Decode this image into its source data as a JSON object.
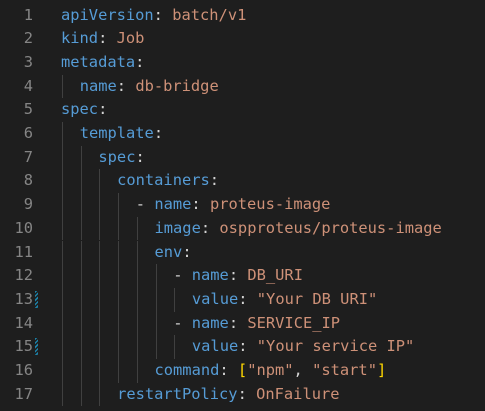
{
  "theme": {
    "background": "#1e1e1e",
    "line_number": "#858585",
    "key": "#569cd6",
    "punctuation": "#d4d4d4",
    "value": "#ce9178",
    "bracket": "#ffd700",
    "modified_gutter": "#1b81a8"
  },
  "lines": [
    {
      "num": "1",
      "indent": 0,
      "tokens": [
        {
          "t": "apiVersion",
          "c": "k"
        },
        {
          "t": ": ",
          "c": "p"
        },
        {
          "t": "batch/v1",
          "c": "v"
        }
      ]
    },
    {
      "num": "2",
      "indent": 0,
      "tokens": [
        {
          "t": "kind",
          "c": "k"
        },
        {
          "t": ": ",
          "c": "p"
        },
        {
          "t": "Job",
          "c": "v"
        }
      ]
    },
    {
      "num": "3",
      "indent": 0,
      "tokens": [
        {
          "t": "metadata",
          "c": "k"
        },
        {
          "t": ":",
          "c": "p"
        }
      ]
    },
    {
      "num": "4",
      "indent": 1,
      "tokens": [
        {
          "t": "name",
          "c": "k"
        },
        {
          "t": ": ",
          "c": "p"
        },
        {
          "t": "db-bridge",
          "c": "v"
        }
      ]
    },
    {
      "num": "5",
      "indent": 0,
      "tokens": [
        {
          "t": "spec",
          "c": "k"
        },
        {
          "t": ":",
          "c": "p"
        }
      ]
    },
    {
      "num": "6",
      "indent": 1,
      "tokens": [
        {
          "t": "template",
          "c": "k"
        },
        {
          "t": ":",
          "c": "p"
        }
      ]
    },
    {
      "num": "7",
      "indent": 2,
      "tokens": [
        {
          "t": "spec",
          "c": "k"
        },
        {
          "t": ":",
          "c": "p"
        }
      ]
    },
    {
      "num": "8",
      "indent": 3,
      "tokens": [
        {
          "t": "containers",
          "c": "k"
        },
        {
          "t": ":",
          "c": "p"
        }
      ]
    },
    {
      "num": "9",
      "indent": 4,
      "tokens": [
        {
          "t": "- ",
          "c": "p"
        },
        {
          "t": "name",
          "c": "k"
        },
        {
          "t": ": ",
          "c": "p"
        },
        {
          "t": "proteus-image",
          "c": "v"
        }
      ]
    },
    {
      "num": "10",
      "indent": 5,
      "tokens": [
        {
          "t": "image",
          "c": "k"
        },
        {
          "t": ": ",
          "c": "p"
        },
        {
          "t": "ospproteus/proteus-image",
          "c": "v"
        }
      ]
    },
    {
      "num": "11",
      "indent": 5,
      "tokens": [
        {
          "t": "env",
          "c": "k"
        },
        {
          "t": ":",
          "c": "p"
        }
      ]
    },
    {
      "num": "12",
      "indent": 6,
      "tokens": [
        {
          "t": "- ",
          "c": "p"
        },
        {
          "t": "name",
          "c": "k"
        },
        {
          "t": ": ",
          "c": "p"
        },
        {
          "t": "DB_URI",
          "c": "v"
        }
      ]
    },
    {
      "num": "13",
      "indent": 7,
      "modified": true,
      "tokens": [
        {
          "t": "value",
          "c": "k"
        },
        {
          "t": ": ",
          "c": "p"
        },
        {
          "t": "\"Your DB URI\"",
          "c": "v"
        }
      ]
    },
    {
      "num": "14",
      "indent": 6,
      "tokens": [
        {
          "t": "- ",
          "c": "p"
        },
        {
          "t": "name",
          "c": "k"
        },
        {
          "t": ": ",
          "c": "p"
        },
        {
          "t": "SERVICE_IP",
          "c": "v"
        }
      ]
    },
    {
      "num": "15",
      "indent": 7,
      "modified": true,
      "tokens": [
        {
          "t": "value",
          "c": "k"
        },
        {
          "t": ": ",
          "c": "p"
        },
        {
          "t": "\"Your service IP\"",
          "c": "v"
        }
      ]
    },
    {
      "num": "16",
      "indent": 5,
      "tokens": [
        {
          "t": "command",
          "c": "k"
        },
        {
          "t": ": ",
          "c": "p"
        },
        {
          "t": "[",
          "c": "b"
        },
        {
          "t": "\"npm\"",
          "c": "v"
        },
        {
          "t": ", ",
          "c": "p"
        },
        {
          "t": "\"start\"",
          "c": "v"
        },
        {
          "t": "]",
          "c": "b"
        }
      ]
    },
    {
      "num": "17",
      "indent": 3,
      "tokens": [
        {
          "t": "restartPolicy",
          "c": "k"
        },
        {
          "t": ": ",
          "c": "p"
        },
        {
          "t": "OnFailure",
          "c": "v"
        }
      ]
    }
  ]
}
